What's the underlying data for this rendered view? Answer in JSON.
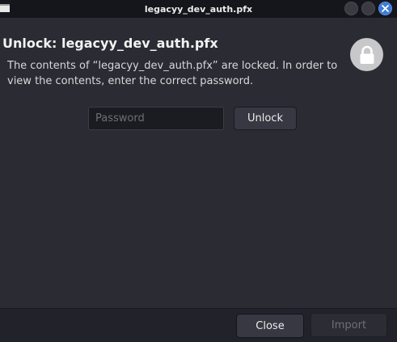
{
  "window": {
    "title": "legacyy_dev_auth.pfx",
    "app_icon": "window-icon",
    "controls": [
      "minimize-icon",
      "maximize-icon",
      "close-icon"
    ],
    "accent": "#3e7bd8"
  },
  "dialog": {
    "heading": "Unlock: legacyy_dev_auth.pfx",
    "description": "The contents of “legacyy_dev_auth.pfx” are locked. In order to view the contents, enter the correct password.",
    "lock_icon": "padlock-icon"
  },
  "form": {
    "password_placeholder": "Password",
    "password_value": "",
    "unlock_label": "Unlock"
  },
  "footer": {
    "close_label": "Close",
    "import_label": "Import",
    "import_enabled": false
  }
}
